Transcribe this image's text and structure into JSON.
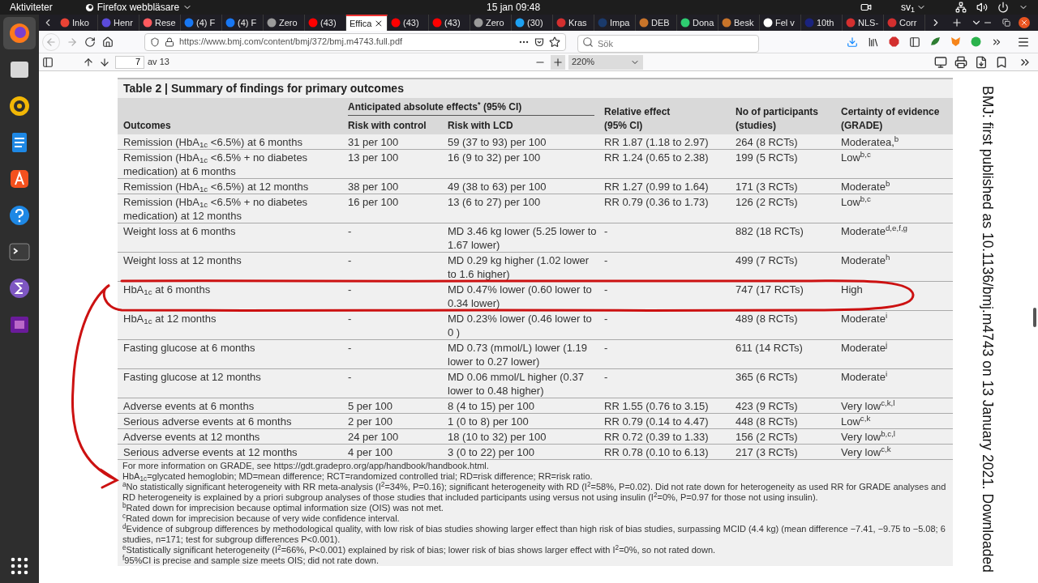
{
  "top_bar": {
    "activities": "Aktiviteter",
    "app_menu": "Firefox webbläsare",
    "clock": "15 jan 09:48",
    "keyboard_layout": "sv$_{1}$"
  },
  "tabs": [
    {
      "title": "Inko",
      "selected": false
    },
    {
      "title": "Henr",
      "selected": false
    },
    {
      "title": "Rese",
      "selected": false
    },
    {
      "title": "(4) F",
      "selected": false
    },
    {
      "title": "(4) F",
      "selected": false
    },
    {
      "title": "Zero",
      "selected": false
    },
    {
      "title": "(43)",
      "selected": false
    },
    {
      "title": "Effica",
      "selected": true
    },
    {
      "title": "(43)",
      "selected": false
    },
    {
      "title": "(43)",
      "selected": false
    },
    {
      "title": "Zero",
      "selected": false
    },
    {
      "title": "(30)",
      "selected": false
    },
    {
      "title": "Kras",
      "selected": false
    },
    {
      "title": "Impa",
      "selected": false
    },
    {
      "title": "DEB",
      "selected": false
    },
    {
      "title": "Dona",
      "selected": false
    },
    {
      "title": "Besk",
      "selected": false
    },
    {
      "title": "Fel v",
      "selected": false
    },
    {
      "title": "10th",
      "selected": false
    },
    {
      "title": "NLS-",
      "selected": false
    },
    {
      "title": "Corr",
      "selected": false
    }
  ],
  "address_bar": {
    "url": "https://www.bmj.com/content/bmj/372/bmj.m4743.full.pdf"
  },
  "search": {
    "placeholder": "Sök"
  },
  "pdf_toolbar": {
    "page": "7",
    "page_count": "av 13",
    "zoom": "220%"
  },
  "document": {
    "title": "Table 2 | Summary of findings for primary outcomes",
    "group_header": "Anticipated absolute effects$^{*}$ (95% CI)",
    "columns": [
      "Outcomes",
      "Risk with control",
      "Risk with LCD",
      "Relative effect (95% CI)",
      "No of participants (studies)",
      "Certainty of evidence (GRADE)"
    ],
    "rows": [
      {
        "outcome": "Remission (HbA$_{1c}$ <6.5%) at 6 months",
        "control": "31 per 100",
        "lcd": "59 (37 to 93) per 100",
        "relative": "RR 1.87 (1.18 to 2.97)",
        "participants": "264 (8 RCTs)",
        "certainty": "Moderatea,$^{b}$"
      },
      {
        "outcome": "Remission (HbA$_{1c}$ <6.5% + no diabetes medication) at 6 months",
        "control": "13 per 100",
        "lcd": "16 (9 to 32) per 100",
        "relative": "RR 1.24 (0.65 to 2.38)",
        "participants": "199 (5 RCTs)",
        "certainty": "Low$^{b,c}$"
      },
      {
        "outcome": "Remission (HbA$_{1c}$ <6.5%) at 12 months",
        "control": "38 per 100",
        "lcd": "49 (38 to 63) per 100",
        "relative": "RR 1.27 (0.99 to 1.64)",
        "participants": "171 (3 RCTs)",
        "certainty": "Moderate$^{b}$"
      },
      {
        "outcome": "Remission (HbA$_{1c}$ <6.5% + no diabetes medication) at 12 months",
        "control": "16 per 100",
        "lcd": "13 (6 to 27) per 100",
        "relative": "RR 0.79 (0.36 to 1.73)",
        "participants": "126 (2 RCTs)",
        "certainty": "Low$^{b,c}$"
      },
      {
        "outcome": "Weight loss at 6 months",
        "control": "-",
        "lcd": "MD 3.46 kg lower (5.25 lower to 1.67 lower)",
        "relative": "-",
        "participants": "882 (18 RCTs)",
        "certainty": "Moderate$^{d,e,f,g}$"
      },
      {
        "outcome": "Weight loss at 12 months",
        "control": "-",
        "lcd": "MD 0.29 kg higher (1.02 lower to 1.6 higher)",
        "relative": "-",
        "participants": "499 (7 RCTs)",
        "certainty": "Moderate$^{h}$"
      },
      {
        "outcome": "HbA$_{1c}$ at 6 months",
        "control": "-",
        "lcd": "MD 0.47% lower (0.60 lower to 0.34 lower)",
        "relative": "-",
        "participants": "747 (17 RCTs)",
        "certainty": "High"
      },
      {
        "outcome": "HbA$_{1c}$ at 12 months",
        "control": "-",
        "lcd": "MD 0.23% lower (0.46 lower to 0 )",
        "relative": "-",
        "participants": "489 (8 RCTs)",
        "certainty": "Moderate$^{i}$"
      },
      {
        "outcome": "Fasting glucose at 6 months",
        "control": "-",
        "lcd": "MD 0.73 (mmol/L) lower (1.19 lower to 0.27 lower)",
        "relative": "-",
        "participants": "611 (14 RCTs)",
        "certainty": "Moderate$^{j}$"
      },
      {
        "outcome": "Fasting glucose at 12 months",
        "control": "-",
        "lcd": "MD 0.06 mmol/L higher (0.37 lower to 0.48 higher)",
        "relative": "-",
        "participants": "365 (6 RCTs)",
        "certainty": "Moderate$^{i}$"
      },
      {
        "outcome": "Adverse events at 6 months",
        "control": "5 per 100",
        "lcd": "8 (4 to 15) per 100",
        "relative": "RR 1.55 (0.76 to 3.15)",
        "participants": "423 (9 RCTs)",
        "certainty": "Very low$^{c,k,l}$"
      },
      {
        "outcome": "Serious adverse events at 6 months",
        "control": "2 per 100",
        "lcd": "1 (0 to 8) per 100",
        "relative": "RR 0.79 (0.14 to 4.47)",
        "participants": "448 (8 RCTs)",
        "certainty": "Low$^{c,k}$"
      },
      {
        "outcome": "Adverse events at 12 months",
        "control": "24 per 100",
        "lcd": "18 (10 to 32) per 100",
        "relative": "RR 0.72 (0.39 to 1.33)",
        "participants": "156 (2 RCTs)",
        "certainty": "Very low$^{b,c,l}$"
      },
      {
        "outcome": "Serious adverse events at 12 months",
        "control": "4 per 100",
        "lcd": "3 (0 to 22) per 100",
        "relative": "RR 0.78 (0.10 to 6.13)",
        "participants": "217 (3 RCTs)",
        "certainty": "Very low$^{c,k}$"
      }
    ],
    "footnotes": [
      "For more information on GRADE, see https://gdt.gradepro.org/app/handbook/handbook.html.",
      "HbA$_{1c}$=glycated hemoglobin; MD=mean difference; RCT=randomized controlled trial; RD=risk difference; RR=risk ratio.",
      "$^{a}$No statistically significant heterogeneity with RR meta-analysis (I$^{2}$=34%, P=0.16); significant heterogeneity with RD (I$^{2}$=58%, P=0.02). Did not rate down for heterogeneity as used RR for GRADE analyses and RD heterogeneity is explained by a priori subgroup analyses of those studies that included participants using versus not using insulin (I$^{2}$=0%, P=0.97 for those not using insulin).",
      "$^{b}$Rated down for imprecision because optimal information size (OIS) was not met.",
      "$^{c}$Rated down for imprecision because of very wide confidence interval.",
      "$^{d}$Evidence of subgroup differences by methodological quality, with low risk of bias studies showing larger effect than high risk of bias studies, surpassing MCID (4.4 kg) (mean difference −7.41, −9.75 to −5.08; 6 studies, n=171; test for subgroup differences P<0.001).",
      "$^{e}$Statistically significant heterogeneity (I$^{2}$=66%, P<0.001) explained by risk of bias; lower risk of bias shows larger effect with I$^{2}$=0%, so not rated down.",
      "$^{f}$95%CI is precise and sample size meets OIS; did not rate down."
    ],
    "side_note": "BMJ: first published as 10.1136/bmj.m4743 on 13 January 2021. Downloaded"
  }
}
